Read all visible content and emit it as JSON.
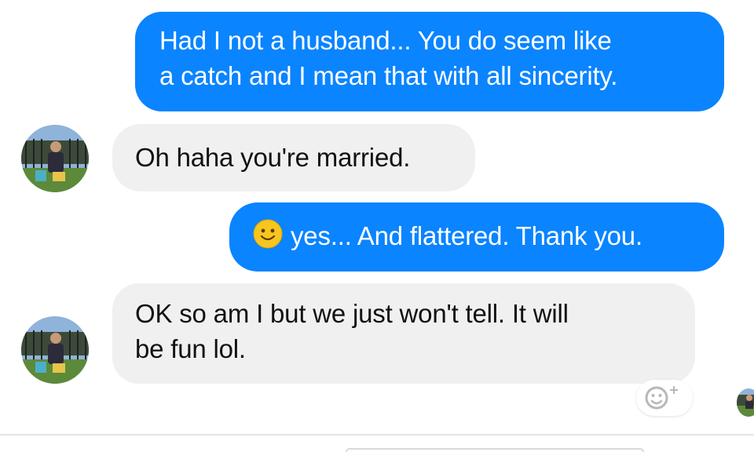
{
  "conversation": {
    "messages": [
      {
        "sender": "me",
        "text": "Had I not a husband... You do seem like\na catch and I mean that with all sincerity."
      },
      {
        "sender": "contact",
        "text": "Oh haha you're married."
      },
      {
        "sender": "me",
        "emoji": "smiley-emoji",
        "text": "yes... And flattered. Thank you."
      },
      {
        "sender": "contact",
        "text": "OK so am I but we just won't tell. It will\nbe fun lol."
      }
    ]
  },
  "colors": {
    "sent_bubble": "#0a84ff",
    "received_bubble": "#f0f0f0",
    "background": "#ffffff"
  },
  "icons": {
    "reaction_button": "add-reaction-icon",
    "avatar": "contact-avatar"
  }
}
